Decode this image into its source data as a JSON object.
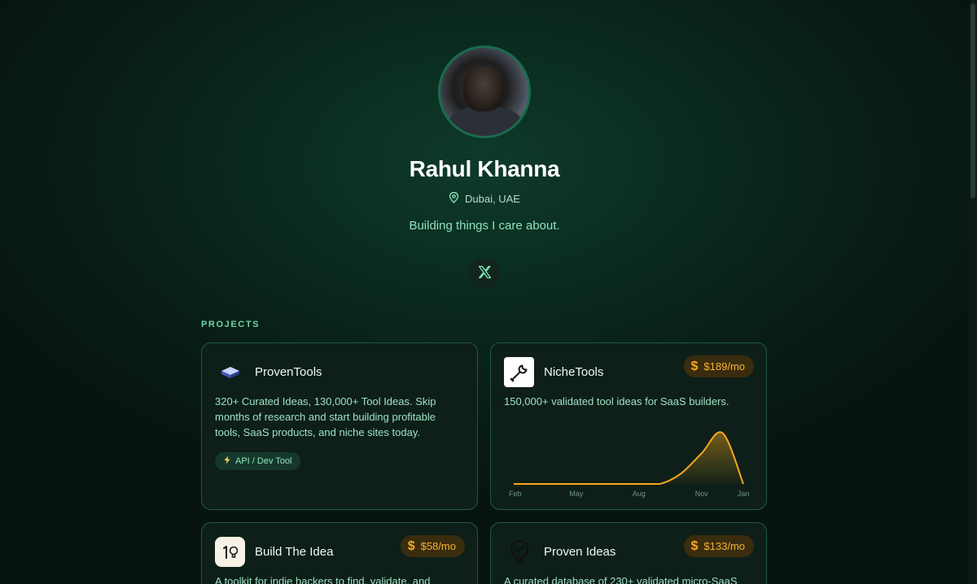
{
  "profile": {
    "name": "Rahul Khanna",
    "location": "Dubai, UAE",
    "tagline": "Building things I care about.",
    "social_icon": "x-logo-icon"
  },
  "projects_section": {
    "title": "PROJECTS"
  },
  "projects": [
    {
      "name": "ProvenTools",
      "icon": "stack-layers-icon",
      "description": "320+ Curated Ideas, 130,000+ Tool Ideas. Skip months of research and start building profitable tools, SaaS products, and niche sites today.",
      "tag": "API / Dev Tool",
      "tag_icon": "lightning-icon"
    },
    {
      "name": "NicheTools",
      "icon": "wrench-icon",
      "description": "150,000+ validated tool ideas for SaaS builders.",
      "revenue": "$189/mo"
    },
    {
      "name": "Build The Idea",
      "icon": "lightbulb-1-icon",
      "description": "A toolkit for indie hackers to find, validate, and",
      "revenue": "$58/mo"
    },
    {
      "name": "Proven Ideas",
      "icon": "check-bulb-icon",
      "description": "A curated database of 230+ validated micro-SaaS",
      "revenue": "$133/mo"
    }
  ],
  "colors": {
    "accent_green": "#6fd6a8",
    "revenue_orange": "#f6a81f",
    "card_border": "#1f5a44"
  },
  "chart_data": {
    "type": "area",
    "x_tick_labels": [
      "Feb",
      "May",
      "Aug",
      "Nov",
      "Jan"
    ],
    "x": [
      "Feb",
      "Mar",
      "Apr",
      "May",
      "Jun",
      "Jul",
      "Aug",
      "Sep",
      "Oct",
      "Nov",
      "Dec",
      "Jan"
    ],
    "values": [
      0,
      0,
      0,
      0,
      0,
      0,
      0,
      0,
      20,
      60,
      100,
      0
    ],
    "ylim": [
      0,
      110
    ],
    "grid": false,
    "color": "#f6a81f"
  }
}
